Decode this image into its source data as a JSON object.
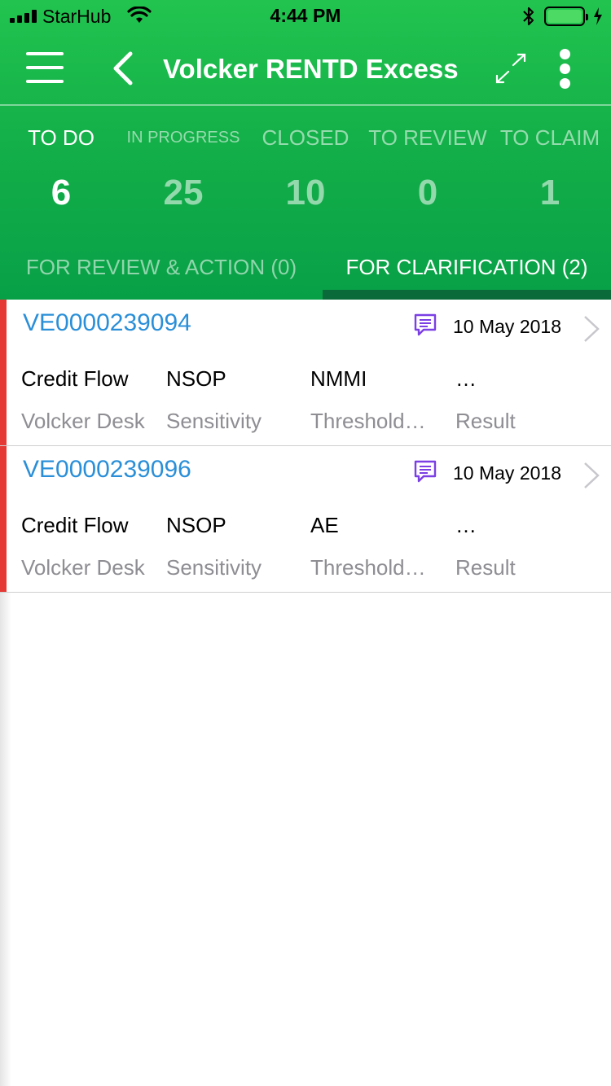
{
  "status_bar": {
    "carrier": "StarHub",
    "time": "4:44 PM",
    "battery_color": "#4cd964"
  },
  "app_bar": {
    "title": "Volcker RENTD Excess",
    "icons": [
      "menu-icon",
      "back-icon",
      "expand-icon",
      "more-vertical-icon"
    ]
  },
  "status_tabs": [
    {
      "label": "TO DO",
      "count": "6",
      "active": true
    },
    {
      "label": "IN PROGRESS",
      "count": "25",
      "active": false
    },
    {
      "label": "CLOSED",
      "count": "10",
      "active": false
    },
    {
      "label": "TO REVIEW",
      "count": "0",
      "active": false
    },
    {
      "label": "TO CLAIM",
      "count": "1",
      "active": false
    }
  ],
  "sub_tabs": [
    {
      "label": "FOR REVIEW  & ACTION (0)",
      "active": false
    },
    {
      "label": "FOR CLARIFICATION (2)",
      "active": true
    }
  ],
  "items": [
    {
      "id": "VE0000239094",
      "date": "10 May 2018",
      "values": [
        "Credit Flow",
        "NSOP",
        "NMMI",
        "…"
      ],
      "captions": [
        "Volcker Desk",
        "Sensitivity",
        "Threshold…",
        "Result"
      ]
    },
    {
      "id": "VE0000239096",
      "date": "10 May 2018",
      "values": [
        "Credit Flow",
        "NSOP",
        "AE",
        "…"
      ],
      "captions": [
        "Volcker Desk",
        "Sensitivity",
        "Threshold…",
        "Result"
      ]
    }
  ],
  "colors": {
    "header_green": "#14b049",
    "link_blue": "#2a8fd8",
    "flag_red": "#e53935",
    "message_icon_purple": "#7b3fe4",
    "tab_indicator": "#0a6a3a"
  }
}
